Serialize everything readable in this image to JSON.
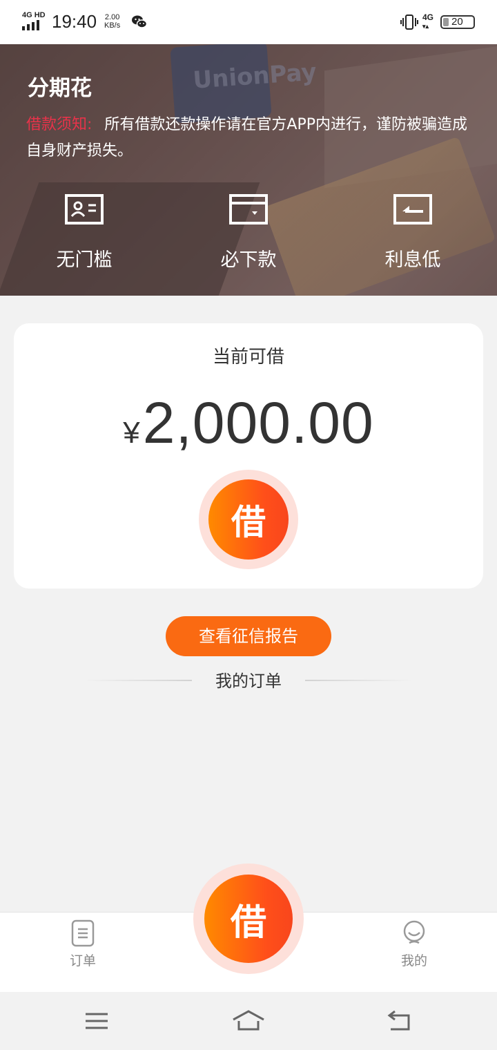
{
  "status_bar": {
    "network_label": "4G HD",
    "time": "19:40",
    "speed_value": "2.00",
    "speed_unit": "KB/s",
    "wechat_icon": "wechat-icon",
    "vibrate_icon": "vibrate-icon",
    "mobile_data": "4G",
    "battery": "20"
  },
  "banner": {
    "app_title": "分期花",
    "notice_label": "借款须知:",
    "notice_text": "所有借款还款操作请在官方APP内进行，谨防被骗造成自身财产损失。",
    "features": [
      {
        "icon": "id-card-icon",
        "label": "无门槛"
      },
      {
        "icon": "wallet-icon",
        "label": "必下款"
      },
      {
        "icon": "return-arrow-icon",
        "label": "利息低"
      }
    ]
  },
  "loan": {
    "label": "当前可借",
    "currency": "¥",
    "amount": "2,000.00",
    "button": "借"
  },
  "credit_report_button": "查看征信报告",
  "orders_title": "我的订单",
  "tabbar": {
    "orders": "订单",
    "borrow": "借",
    "mine": "我的"
  },
  "colors": {
    "accent": "#fa6a12",
    "notice_red": "#e8334a",
    "button_gradient_start": "#ff8a00",
    "button_gradient_end": "#f8461c",
    "halo": "#fde0da"
  }
}
